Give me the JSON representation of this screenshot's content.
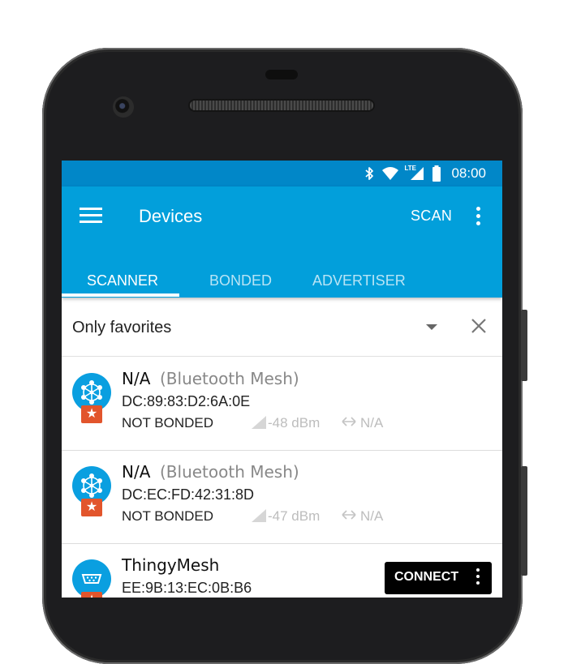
{
  "status_bar": {
    "time": "08:00",
    "network_label": "LTE",
    "icons": [
      "bluetooth-icon",
      "wifi-icon",
      "lte-signal-icon",
      "battery-icon"
    ]
  },
  "app_bar": {
    "title": "Devices",
    "scan_label": "SCAN",
    "menu_icon": "menu-icon",
    "overflow_icon": "more-vert-icon"
  },
  "tabs": [
    {
      "label": "SCANNER",
      "active": true
    },
    {
      "label": "BONDED",
      "active": false
    },
    {
      "label": "ADVERTISER",
      "active": false
    }
  ],
  "filter": {
    "label": "Only favorites",
    "dropdown_icon": "arrow-drop-down-icon",
    "clear_icon": "close-icon"
  },
  "devices": [
    {
      "name": "N/A",
      "type": "(Bluetooth Mesh)",
      "address": "DC:89:83:D2:6A:0E",
      "bond_state": "NOT BONDED",
      "rssi": "-48 dBm",
      "interval": "N/A",
      "icon": "bluetooth-mesh-icon",
      "favorite": true
    },
    {
      "name": "N/A",
      "type": "(Bluetooth Mesh)",
      "address": "DC:EC:FD:42:31:8D",
      "bond_state": "NOT BONDED",
      "rssi": "-47 dBm",
      "interval": "N/A",
      "icon": "bluetooth-mesh-icon",
      "favorite": true
    },
    {
      "name": "ThingyMesh",
      "address": "EE:9B:13:EC:0B:B6",
      "connect_label": "CONNECT",
      "icon": "serial-port-icon",
      "favorite": true
    }
  ],
  "colors": {
    "status_bar": "#0187c8",
    "app_bar": "#029fdb",
    "device_icon": "#0a9fe0",
    "favorite_badge": "#e2552c",
    "connect_button": "#000000"
  }
}
